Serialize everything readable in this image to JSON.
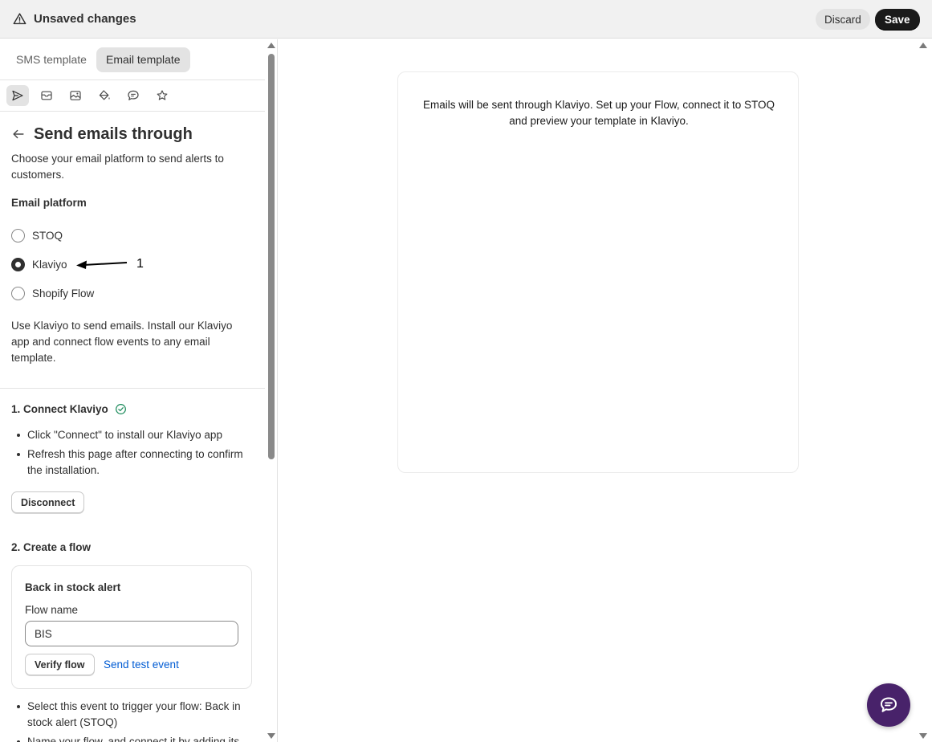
{
  "topbar": {
    "title": "Unsaved changes",
    "discard_label": "Discard",
    "save_label": "Save"
  },
  "tabs": [
    {
      "label": "SMS template",
      "active": false
    },
    {
      "label": "Email template",
      "active": true
    }
  ],
  "toolbar_icons": [
    "send-icon",
    "mail-icon",
    "image-icon",
    "paint-bucket-icon",
    "chat-bubble-icon",
    "star-icon"
  ],
  "panel": {
    "title": "Send emails through",
    "description": "Choose your email platform to send alerts to customers.",
    "section_label": "Email platform",
    "platforms": [
      {
        "label": "STOQ",
        "checked": false
      },
      {
        "label": "Klaviyo",
        "checked": true
      },
      {
        "label": "Shopify Flow",
        "checked": false
      }
    ],
    "annotation_number": "1",
    "klaviyo_description": "Use Klaviyo to send emails. Install our Klaviyo app and connect flow events to any email template.",
    "step1": {
      "title": "1. Connect Klaviyo",
      "bullets": [
        "Click \"Connect\" to install our Klaviyo app",
        "Refresh this page after connecting to confirm the installation."
      ],
      "button_label": "Disconnect"
    },
    "step2": {
      "title": "2. Create a flow",
      "card": {
        "title": "Back in stock alert",
        "field_label": "Flow name",
        "field_value": "BIS",
        "verify_label": "Verify flow",
        "test_link": "Send test event"
      },
      "bullets": [
        "Select this event to trigger your flow: Back in stock alert (STOQ)",
        "Name your flow, and connect it by adding its"
      ]
    }
  },
  "preview": {
    "text": "Emails will be sent through Klaviyo. Set up your Flow, connect it to STOQ and preview your template in Klaviyo."
  },
  "colors": {
    "accent_link": "#005bd3",
    "save_button": "#1a1a1a",
    "chat_button": "#48226a",
    "success_check": "#1a8a5a"
  }
}
